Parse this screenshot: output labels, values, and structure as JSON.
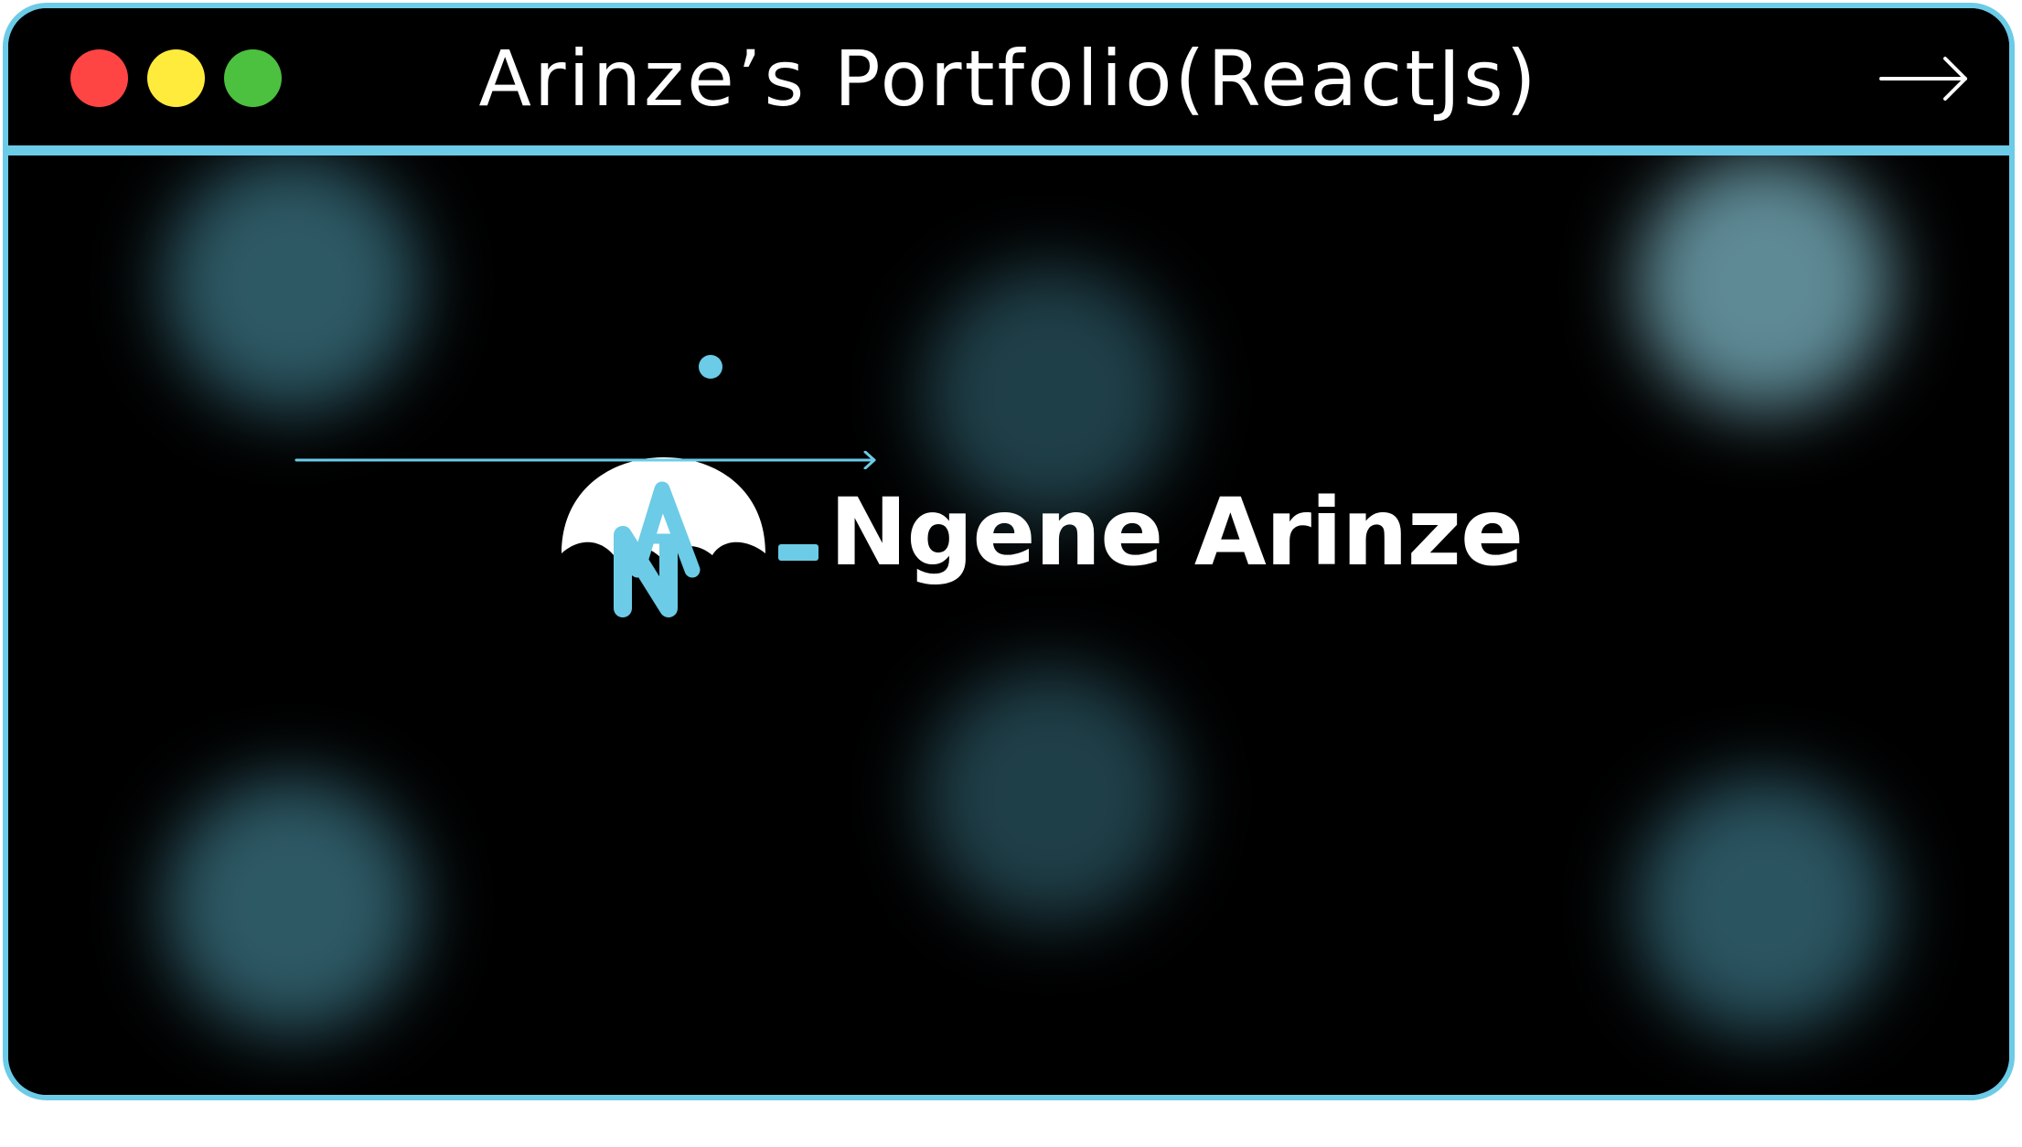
{
  "window": {
    "title": "Arinze’s Portfolio(ReactJs)",
    "controls": [
      {
        "name": "close",
        "color": "#ff4444"
      },
      {
        "name": "minimize",
        "color": "#ffeb3b"
      },
      {
        "name": "maximize",
        "color": "#4cc03f"
      }
    ],
    "nav_icon": "arrow-right-icon"
  },
  "brand": {
    "logo_text": "NA",
    "logo_icon": "na-umbrella-logo-icon",
    "separator": "-",
    "name": "Ngene Arinze",
    "underline_icon": "arrow-right-icon"
  },
  "colors": {
    "accent": "#6ccbe6",
    "background": "#000000",
    "text": "#ffffff",
    "glow": "#2d5965",
    "glow_bright": "#5e8a95"
  }
}
